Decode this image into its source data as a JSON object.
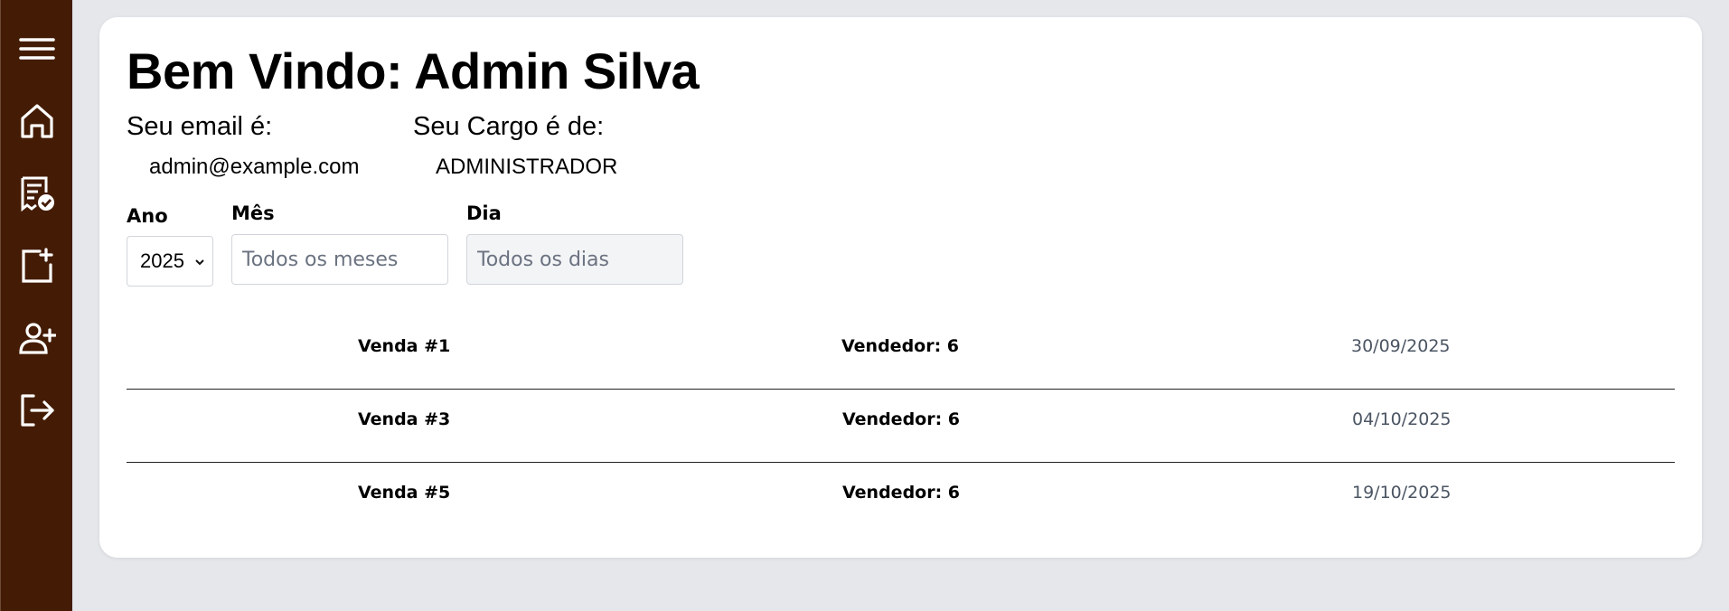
{
  "sidebar": {
    "items": [
      {
        "icon": "menu-icon"
      },
      {
        "icon": "home-icon"
      },
      {
        "icon": "receipt-check-icon"
      },
      {
        "icon": "add-document-icon"
      },
      {
        "icon": "add-user-icon"
      },
      {
        "icon": "logout-icon"
      }
    ]
  },
  "header": {
    "welcome": "Bem Vindo: Admin Silva"
  },
  "user": {
    "email_label": "Seu email é:",
    "email": "admin@example.com",
    "role_label": "Seu Cargo é de:",
    "role": "ADMINISTRADOR"
  },
  "filters": {
    "year_label": "Ano",
    "year_value": "2025",
    "month_label": "Mês",
    "month_placeholder": "Todos os meses",
    "day_label": "Dia",
    "day_placeholder": "Todos os dias"
  },
  "sales": [
    {
      "id": "Venda #1",
      "seller": "Vendedor: 6",
      "date": "30/09/2025"
    },
    {
      "id": "Venda #3",
      "seller": "Vendedor: 6",
      "date": "04/10/2025"
    },
    {
      "id": "Venda #5",
      "seller": "Vendedor: 6",
      "date": "19/10/2025"
    }
  ],
  "colors": {
    "sidebar": "#441c05",
    "background": "#e5e7eb",
    "card": "#ffffff"
  }
}
